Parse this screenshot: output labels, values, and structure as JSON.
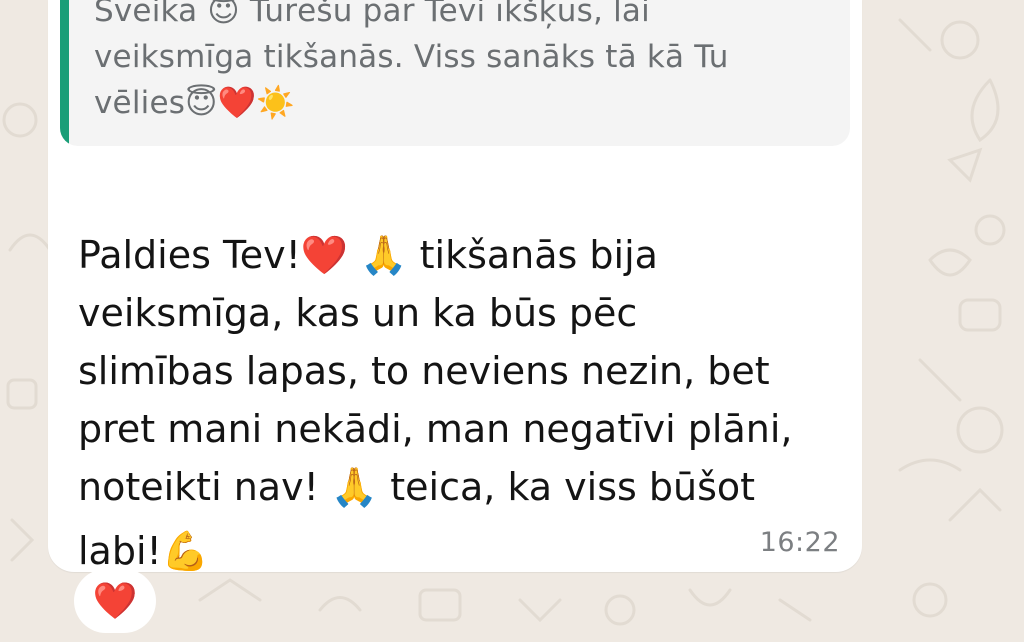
{
  "quoted_message": {
    "text": "Sveika 😇 Turēšu par Tevi īkšķus,  lai\nveiksmīga tikšanās. Viss sanāks tā kā Tu\nvēlies😇❤️☀️"
  },
  "message": {
    "text_main": "Paldies Tev!❤️ 🙏 tikšanās bija\nveiksmīga, kas un ka būs pēc\nslimības lapas, to neviens nezin, bet\npret mani nekādi, man negatīvi plāni,\nnoteikti nav! 🙏 teica, ka viss būšot",
    "text_last": "labi!💪",
    "time": "16:22"
  },
  "reaction": {
    "emoji": "❤️"
  },
  "colors": {
    "wallpaper": "#efe9e2",
    "bubble": "#ffffff",
    "quote_background": "#f4f4f4",
    "quote_bar": "#1a9e78",
    "quote_text": "#6b6f72",
    "message_text": "#141414",
    "time_text": "#7c7f82"
  }
}
